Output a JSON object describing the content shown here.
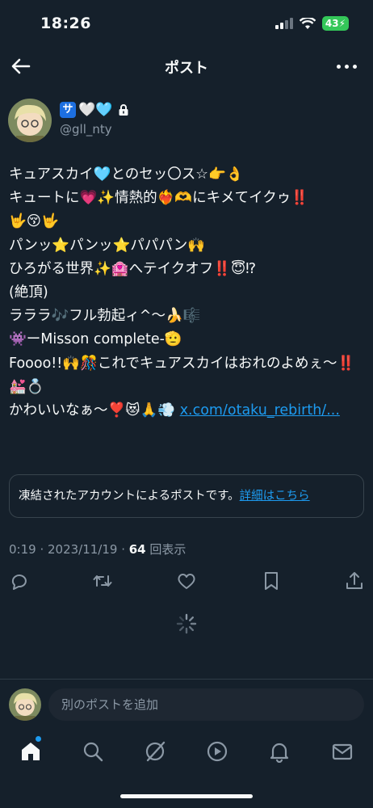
{
  "status": {
    "time": "18:26",
    "battery": "43"
  },
  "nav": {
    "title": "ポスト"
  },
  "author": {
    "name_emoji": "🤍🩵",
    "sa_badge": "サ",
    "handle": "@gll_nty"
  },
  "post": {
    "text": "キュアスカイ🩵とのセッ〇ス☆👉👌\nキュートに💗✨情熱的❤️‍🔥🫶にキメてイクゥ‼️\n🤟😚🤟\nパンッ⭐️パンッ⭐️パパパン🙌\nひろがる世界✨🏩へテイクオフ‼️😇⁉\n(絶頂)\nラララ🎶フル勃起ィ^〜🍌🎼\n👾ーMisson complete-🫡\nFoooo!!🙌🎊これでキュアスカイはおれのよめぇ〜‼️💒💍\nかわいいなぁ〜❣️😻🙏💨 ",
    "link": "x.com/otaku_rebirth/..."
  },
  "notice": {
    "text": "凍結されたアカウントによるポストです。",
    "link": "詳細はこちら"
  },
  "meta": {
    "time_date": "0:19 · 2023/11/19 · ",
    "views": "64",
    "views_label": " 回表示"
  },
  "actions": [
    "reply-icon",
    "repost-icon",
    "like-icon",
    "bookmark-icon",
    "share-icon"
  ],
  "reply": {
    "placeholder": "別のポストを追加"
  },
  "tabs": [
    "home-icon",
    "search-icon",
    "grok-icon",
    "video-icon",
    "notifications-icon",
    "messages-icon"
  ],
  "colors": {
    "background": "#15202b",
    "accent": "#1d9bf0",
    "muted": "#8b98a5",
    "battery": "#34c759"
  }
}
